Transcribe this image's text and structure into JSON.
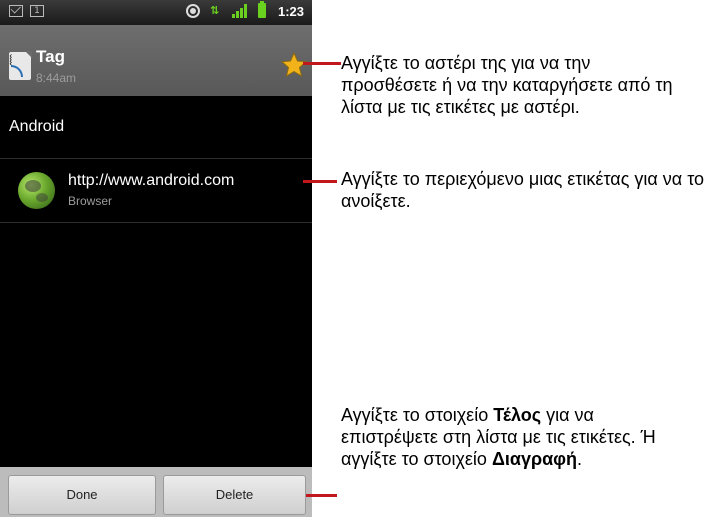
{
  "status_bar": {
    "icons": [
      "mail-icon",
      "calendar-icon",
      "gps-icon",
      "data-transfer-icon",
      "signal-icon",
      "battery-icon"
    ],
    "calendar_day": "1",
    "time": "1:23"
  },
  "tag": {
    "title": "Tag",
    "time": "8:44am",
    "star_icon": "star-icon"
  },
  "list": {
    "group_label": "Android",
    "item": {
      "url": "http://www.android.com",
      "app": "Browser",
      "icon": "globe-icon"
    }
  },
  "buttons": {
    "done": "Done",
    "delete": "Delete"
  },
  "callouts": {
    "star": "Αγγίξτε το αστέρι της για να την προσθέσετε ή να την καταργήσετε από τη λίστα με τις ετικέτες με αστέρι.",
    "content": "Αγγίξτε το περιεχόμενο μιας ετικέτας για να το ανοίξετε.",
    "buttons_part1": "Αγγίξτε το στοιχείο ",
    "buttons_done": "Τέλος",
    "buttons_part2": " για να επιστρέψετε στη λίστα με τις ετικέτες. Ή αγγίξτε το στοιχείο ",
    "buttons_delete": "Διαγραφή",
    "buttons_part3": "."
  },
  "colors": {
    "callout_line": "#c0161c",
    "status_green": "#6ad11e"
  }
}
